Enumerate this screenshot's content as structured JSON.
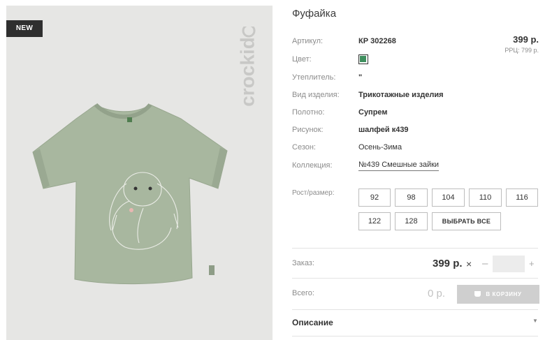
{
  "product": {
    "badge": "NEW",
    "brand": "crockid",
    "title": "Фуфайка"
  },
  "price": {
    "value": "399 р.",
    "rrp": "РРЦ: 799 р."
  },
  "attributes": [
    {
      "label": "Артикул:",
      "value": "КР 302268"
    },
    {
      "label": "Цвет:",
      "color": "#3f8f5e"
    },
    {
      "label": "Утеплитель:",
      "value": "\""
    },
    {
      "label": "Вид изделия:",
      "value": "Трикотажные изделия"
    },
    {
      "label": "Полотно:",
      "value": "Супрем"
    },
    {
      "label": "Рисунок:",
      "value": "шалфей к439"
    },
    {
      "label": "Сезон:",
      "value": "Осень-Зима"
    },
    {
      "label": "Коллекция:",
      "value": "№439 Смешные зайки"
    }
  ],
  "sizes": {
    "label": "Рост/размер:",
    "options": [
      "92",
      "98",
      "104",
      "110",
      "116",
      "122",
      "128"
    ],
    "select_all": "ВЫБРАТЬ ВСЕ"
  },
  "order": {
    "label": "Заказ:",
    "price": "399 р.",
    "times": "×",
    "minus": "–",
    "plus": "+",
    "quantity": ""
  },
  "total": {
    "label": "Всего:",
    "value": "0 р.",
    "cart_button": "В КОРЗИНУ"
  },
  "description": {
    "title": "Описание"
  },
  "colors": {
    "swatch": "#3f8f5e",
    "shirt": "#a7b79e",
    "badge_bg": "#2f2f2f",
    "cart_disabled": "#cfcfcf"
  }
}
